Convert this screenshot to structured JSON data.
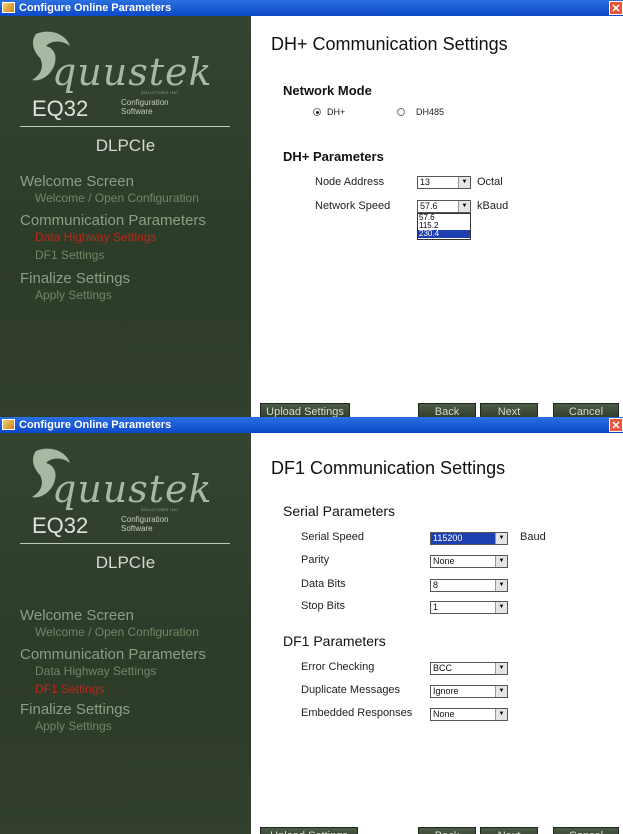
{
  "window_title": "Configure Online Parameters",
  "close_glyph": "✕",
  "logo": {
    "word": "quustek",
    "tagline": "SOLUTIONS INC",
    "eq": "EQ32",
    "config": "Configuration",
    "software": "Software",
    "product": "DLPCIe"
  },
  "nav": {
    "welcome": "Welcome Screen",
    "welcome_open": "Welcome / Open Configuration",
    "comm": "Communication Parameters",
    "dh": "Data Highway Settings",
    "df1": "DF1 Settings",
    "finalize": "Finalize Settings",
    "apply": "Apply Settings"
  },
  "buttons": {
    "upload": "Upload Settings",
    "back": "Back",
    "next": "Next",
    "cancel": "Cancel"
  },
  "screen1": {
    "title": "DH+ Communication Settings",
    "network_mode": "Network Mode",
    "radio_dh": "DH+",
    "radio_dh485": "DH485",
    "selected_mode": "DH+",
    "params_heading": "DH+ Parameters",
    "node_address_label": "Node Address",
    "node_address_value": "13",
    "node_address_unit": "Octal",
    "network_speed_label": "Network Speed",
    "network_speed_value": "57.6",
    "network_speed_unit": "kBaud",
    "speed_options": [
      "57.6",
      "115.2",
      "230.4"
    ],
    "speed_highlighted": "230.4"
  },
  "screen2": {
    "title": "DF1 Communication Settings",
    "serial_heading": "Serial Parameters",
    "serial_speed_label": "Serial Speed",
    "serial_speed_value": "115200",
    "serial_speed_unit": "Baud",
    "parity_label": "Parity",
    "parity_value": "None",
    "data_bits_label": "Data Bits",
    "data_bits_value": "8",
    "stop_bits_label": "Stop Bits",
    "stop_bits_value": "1",
    "df1_heading": "DF1 Parameters",
    "error_checking_label": "Error Checking",
    "error_checking_value": "BCC",
    "duplicate_label": "Duplicate Messages",
    "duplicate_value": "Ignore",
    "embedded_label": "Embedded Responses",
    "embedded_value": "None"
  }
}
